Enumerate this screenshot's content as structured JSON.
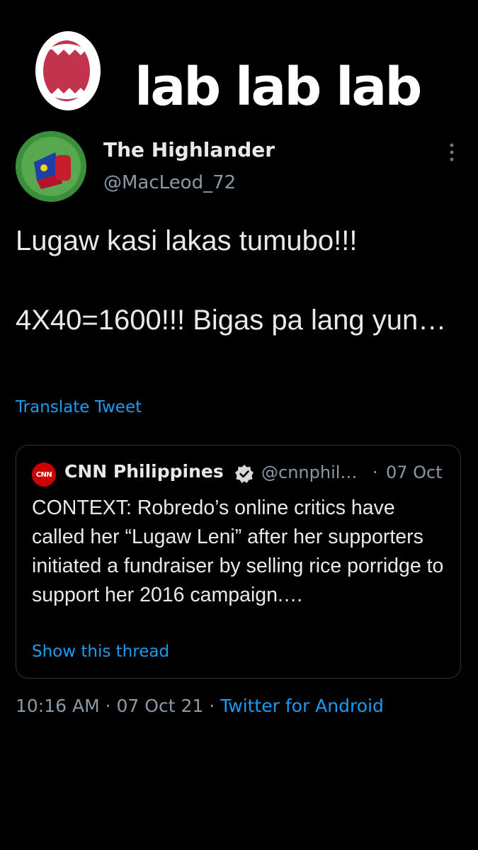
{
  "logo": {
    "text": "lab lab lab",
    "icon": "mouth-icon"
  },
  "author": {
    "name": "The Highlander",
    "handle": "@MacLeod_72",
    "avatar_icon": "fist-flag-avatar"
  },
  "tweet": {
    "text": "Lugaw kasi lakas tumubo!!!\n\n4X40=1600!!! Bigas pa lang yun…",
    "translate_label": "Translate Tweet"
  },
  "quoted": {
    "logo_text": "CNN",
    "name": "CNN Philippines",
    "handle": "@cnnphil…",
    "separator": "·",
    "date": "07 Oct",
    "text": "CONTEXT: Robredo’s online critics have called her “Lugaw Leni” after her supporters initiated a fundraiser by selling rice porridge to support her 2016 campaign.…",
    "show_thread": "Show this thread"
  },
  "meta": {
    "time": "10:16 AM",
    "sep1": " · ",
    "date": "07 Oct 21",
    "sep2": " · ",
    "source": "Twitter for Android"
  },
  "colors": {
    "background": "#000000",
    "link": "#1d9bf0",
    "muted": "#8b98a5",
    "logo_mouth": "#c2334d"
  }
}
